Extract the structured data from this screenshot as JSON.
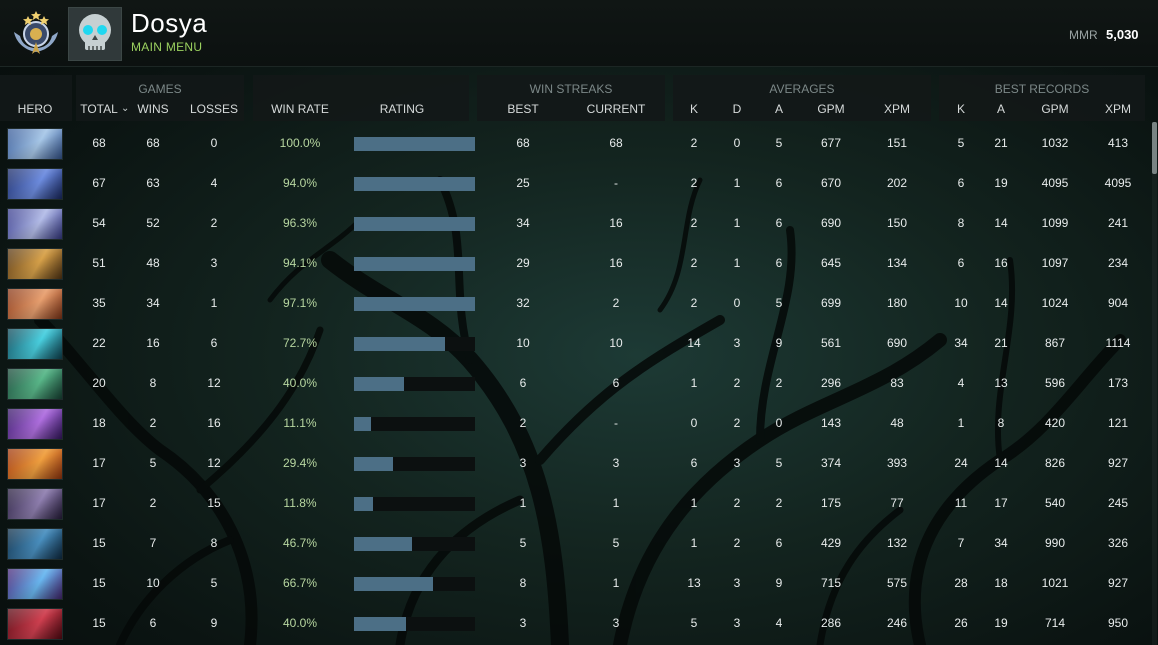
{
  "player": {
    "name": "Dosya",
    "subtitle": "MAIN MENU"
  },
  "mmr": {
    "label": "MMR",
    "value": "5,030"
  },
  "groups": {
    "games": "GAMES",
    "win_streaks": "WIN STREAKS",
    "averages": "AVERAGES",
    "best_records": "BEST RECORDS"
  },
  "columns": {
    "hero": "HERO",
    "total": "TOTAL",
    "wins": "WINS",
    "losses": "LOSSES",
    "win_rate": "WIN RATE",
    "rating": "RATING",
    "streak_best": "BEST",
    "streak_current": "CURRENT",
    "avg_k": "K",
    "avg_d": "D",
    "avg_a": "A",
    "avg_gpm": "GPM",
    "avg_xpm": "XPM",
    "best_k": "K",
    "best_a": "A",
    "best_gpm": "GPM",
    "best_xpm": "XPM"
  },
  "sort_icon": "chevron-down-icon",
  "rows": [
    {
      "total": "68",
      "wins": "68",
      "losses": "0",
      "win_rate": "100.0%",
      "rating": 1.0,
      "streak_best": "68",
      "streak_current": "68",
      "k": "2",
      "d": "0",
      "a": "5",
      "gpm": "677",
      "xpm": "151",
      "best_k": "5",
      "best_a": "21",
      "best_gpm": "1032",
      "best_xpm": "413",
      "c1": "#3a5d9a",
      "c2": "#a8c8e8"
    },
    {
      "total": "67",
      "wins": "63",
      "losses": "4",
      "win_rate": "94.0%",
      "rating": 1.0,
      "streak_best": "25",
      "streak_current": "-",
      "k": "2",
      "d": "1",
      "a": "6",
      "gpm": "670",
      "xpm": "202",
      "best_k": "6",
      "best_a": "19",
      "best_gpm": "4095",
      "best_xpm": "4095",
      "c1": "#1c2d6a",
      "c2": "#6e8de0"
    },
    {
      "total": "54",
      "wins": "52",
      "losses": "2",
      "win_rate": "96.3%",
      "rating": 1.0,
      "streak_best": "34",
      "streak_current": "16",
      "k": "2",
      "d": "1",
      "a": "6",
      "gpm": "690",
      "xpm": "150",
      "best_k": "8",
      "best_a": "14",
      "best_gpm": "1099",
      "best_xpm": "241",
      "c1": "#3b3f8f",
      "c2": "#b4bde8"
    },
    {
      "total": "51",
      "wins": "48",
      "losses": "3",
      "win_rate": "94.1%",
      "rating": 1.0,
      "streak_best": "29",
      "streak_current": "16",
      "k": "2",
      "d": "1",
      "a": "6",
      "gpm": "645",
      "xpm": "134",
      "best_k": "6",
      "best_a": "16",
      "best_gpm": "1097",
      "best_xpm": "234",
      "c1": "#5a3a16",
      "c2": "#d8a24a"
    },
    {
      "total": "35",
      "wins": "34",
      "losses": "1",
      "win_rate": "97.1%",
      "rating": 1.0,
      "streak_best": "32",
      "streak_current": "2",
      "k": "2",
      "d": "0",
      "a": "5",
      "gpm": "699",
      "xpm": "180",
      "best_k": "10",
      "best_a": "14",
      "best_gpm": "1024",
      "best_xpm": "904",
      "c1": "#8a3a1a",
      "c2": "#e8a070"
    },
    {
      "total": "22",
      "wins": "16",
      "losses": "6",
      "win_rate": "72.7%",
      "rating": 0.75,
      "streak_best": "10",
      "streak_current": "10",
      "k": "14",
      "d": "3",
      "a": "9",
      "gpm": "561",
      "xpm": "690",
      "best_k": "34",
      "best_a": "21",
      "best_gpm": "867",
      "best_xpm": "1114",
      "c1": "#104a5a",
      "c2": "#4ad0e0"
    },
    {
      "total": "20",
      "wins": "8",
      "losses": "12",
      "win_rate": "40.0%",
      "rating": 0.41,
      "streak_best": "6",
      "streak_current": "6",
      "k": "1",
      "d": "2",
      "a": "2",
      "gpm": "296",
      "xpm": "83",
      "best_k": "4",
      "best_a": "13",
      "best_gpm": "596",
      "best_xpm": "173",
      "c1": "#1a4a3a",
      "c2": "#5ab88a"
    },
    {
      "total": "18",
      "wins": "2",
      "losses": "16",
      "win_rate": "11.1%",
      "rating": 0.14,
      "streak_best": "2",
      "streak_current": "-",
      "k": "0",
      "d": "2",
      "a": "0",
      "gpm": "143",
      "xpm": "48",
      "best_k": "1",
      "best_a": "8",
      "best_gpm": "420",
      "best_xpm": "121",
      "c1": "#3a1a6a",
      "c2": "#b070e0"
    },
    {
      "total": "17",
      "wins": "5",
      "losses": "12",
      "win_rate": "29.4%",
      "rating": 0.32,
      "streak_best": "3",
      "streak_current": "3",
      "k": "6",
      "d": "3",
      "a": "5",
      "gpm": "374",
      "xpm": "393",
      "best_k": "24",
      "best_a": "14",
      "best_gpm": "826",
      "best_xpm": "927",
      "c1": "#a03a10",
      "c2": "#f0a040"
    },
    {
      "total": "17",
      "wins": "2",
      "losses": "15",
      "win_rate": "11.8%",
      "rating": 0.16,
      "streak_best": "1",
      "streak_current": "1",
      "k": "1",
      "d": "2",
      "a": "2",
      "gpm": "175",
      "xpm": "77",
      "best_k": "11",
      "best_a": "17",
      "best_gpm": "540",
      "best_xpm": "245",
      "c1": "#2a2040",
      "c2": "#9080b0"
    },
    {
      "total": "15",
      "wins": "7",
      "losses": "8",
      "win_rate": "46.7%",
      "rating": 0.48,
      "streak_best": "5",
      "streak_current": "5",
      "k": "1",
      "d": "2",
      "a": "6",
      "gpm": "429",
      "xpm": "132",
      "best_k": "7",
      "best_a": "34",
      "best_gpm": "990",
      "best_xpm": "326",
      "c1": "#10304a",
      "c2": "#4a90c0"
    },
    {
      "total": "15",
      "wins": "10",
      "losses": "5",
      "win_rate": "66.7%",
      "rating": 0.65,
      "streak_best": "8",
      "streak_current": "1",
      "k": "13",
      "d": "3",
      "a": "9",
      "gpm": "715",
      "xpm": "575",
      "best_k": "28",
      "best_a": "18",
      "best_gpm": "1021",
      "best_xpm": "927",
      "c1": "#4a2a7a",
      "c2": "#6ab8f0"
    },
    {
      "total": "15",
      "wins": "6",
      "losses": "9",
      "win_rate": "40.0%",
      "rating": 0.43,
      "streak_best": "3",
      "streak_current": "3",
      "k": "5",
      "d": "3",
      "a": "4",
      "gpm": "286",
      "xpm": "246",
      "best_k": "26",
      "best_a": "19",
      "best_gpm": "714",
      "best_xpm": "950",
      "c1": "#5a0a14",
      "c2": "#d04050"
    }
  ]
}
